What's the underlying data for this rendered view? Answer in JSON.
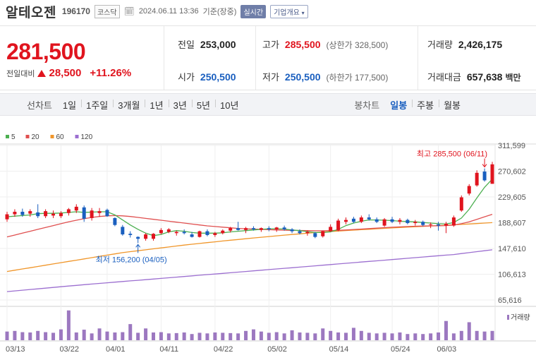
{
  "header": {
    "name": "알테오젠",
    "code": "196170",
    "market_badge": "코스닥",
    "datetime": "2024.06.11 13:36",
    "basis": "기준(장중)",
    "live_label": "실시간",
    "corp_label": "기업개요"
  },
  "quote": {
    "price": "281,500",
    "change_label": "전일대비",
    "change_amount": "28,500",
    "change_pct": "+11.26%",
    "prev_label": "전일",
    "prev_value": "253,000",
    "high_label": "고가",
    "high_value": "285,500",
    "upper_limit_text": "(상한가 328,500)",
    "volume_label": "거래량",
    "volume_value": "2,426,175",
    "open_label": "시가",
    "open_value": "250,500",
    "low_label": "저가",
    "low_value": "250,500",
    "lower_limit_text": "(하한가 177,500)",
    "amount_label": "거래대금",
    "amount_value": "657,638",
    "amount_unit": "백만"
  },
  "periods": {
    "line_label": "선차트",
    "line_items": [
      "1일",
      "1주일",
      "3개월",
      "1년",
      "3년",
      "5년",
      "10년"
    ],
    "candle_label": "봉차트",
    "candle_items": [
      "일봉",
      "주봉",
      "월봉"
    ],
    "candle_selected": 0
  },
  "colors": {
    "up": "#e0141e",
    "down": "#1a5fbf",
    "ma5": "#4caf50",
    "ma20": "#e05050",
    "ma60": "#f0962a",
    "ma120": "#9c6fd0",
    "volume": "#9c78c0"
  },
  "chart_data": {
    "type": "candlestick",
    "legend": [
      {
        "name": "5",
        "color": "#4caf50"
      },
      {
        "name": "20",
        "color": "#e05050"
      },
      {
        "name": "60",
        "color": "#f0962a"
      },
      {
        "name": "120",
        "color": "#9c6fd0"
      }
    ],
    "y_ticks": [
      "311,599",
      "270,602",
      "229,605",
      "188,607",
      "147,610",
      "106,613",
      "65,616"
    ],
    "y_tick_values": [
      311599,
      270602,
      229605,
      188607,
      147610,
      106613,
      65616
    ],
    "ylim": [
      65616,
      311599
    ],
    "x_tick_labels": [
      "03/13",
      "03/22",
      "04/01",
      "04/11",
      "04/22",
      "05/02",
      "05/14",
      "05/24",
      "06/03"
    ],
    "x_tick_index": [
      0,
      7,
      13,
      20,
      27,
      34,
      42,
      50,
      56
    ],
    "high_annotation": "최고 285,500 (06/11)",
    "low_annotation": "최저 156,200 (04/05)",
    "high_index": 62,
    "low_index": 17,
    "volume_label": "거래량",
    "candles": [
      {
        "o": 194000,
        "h": 206000,
        "l": 190000,
        "c": 202000
      },
      {
        "o": 202000,
        "h": 210000,
        "l": 198000,
        "c": 206000
      },
      {
        "o": 206000,
        "h": 211000,
        "l": 198000,
        "c": 201000
      },
      {
        "o": 203000,
        "h": 210000,
        "l": 198000,
        "c": 207000
      },
      {
        "o": 205000,
        "h": 218000,
        "l": 196000,
        "c": 199000
      },
      {
        "o": 199000,
        "h": 210000,
        "l": 196000,
        "c": 207000
      },
      {
        "o": 200000,
        "h": 208000,
        "l": 196000,
        "c": 203000
      },
      {
        "o": 199000,
        "h": 207000,
        "l": 196000,
        "c": 204000
      },
      {
        "o": 204000,
        "h": 212000,
        "l": 200000,
        "c": 210000
      },
      {
        "o": 208000,
        "h": 218000,
        "l": 204000,
        "c": 214000
      },
      {
        "o": 213000,
        "h": 216000,
        "l": 190000,
        "c": 195000
      },
      {
        "o": 196000,
        "h": 212000,
        "l": 192000,
        "c": 208000
      },
      {
        "o": 204000,
        "h": 212000,
        "l": 198000,
        "c": 207000
      },
      {
        "o": 209000,
        "h": 211000,
        "l": 198000,
        "c": 199000
      },
      {
        "o": 196000,
        "h": 197000,
        "l": 183000,
        "c": 185000
      },
      {
        "o": 182000,
        "h": 185000,
        "l": 168000,
        "c": 170000
      },
      {
        "o": 171000,
        "h": 175000,
        "l": 165000,
        "c": 169000
      },
      {
        "o": 166000,
        "h": 167000,
        "l": 156200,
        "c": 163000
      },
      {
        "o": 163000,
        "h": 172000,
        "l": 160000,
        "c": 170000
      },
      {
        "o": 163000,
        "h": 172000,
        "l": 160000,
        "c": 171000
      },
      {
        "o": 172000,
        "h": 180000,
        "l": 170000,
        "c": 177000
      },
      {
        "o": 174000,
        "h": 180000,
        "l": 172000,
        "c": 178000
      },
      {
        "o": 172000,
        "h": 176000,
        "l": 168000,
        "c": 174000
      },
      {
        "o": 174000,
        "h": 178000,
        "l": 170000,
        "c": 172000
      },
      {
        "o": 170000,
        "h": 174000,
        "l": 165000,
        "c": 166000
      },
      {
        "o": 166000,
        "h": 176000,
        "l": 165000,
        "c": 175000
      },
      {
        "o": 175000,
        "h": 178000,
        "l": 167000,
        "c": 169000
      },
      {
        "o": 169000,
        "h": 174000,
        "l": 166000,
        "c": 172000
      },
      {
        "o": 172000,
        "h": 178000,
        "l": 170000,
        "c": 176000
      },
      {
        "o": 176000,
        "h": 182000,
        "l": 173000,
        "c": 180000
      },
      {
        "o": 180000,
        "h": 190000,
        "l": 176000,
        "c": 177000
      },
      {
        "o": 177000,
        "h": 182000,
        "l": 172000,
        "c": 180000
      },
      {
        "o": 180000,
        "h": 183000,
        "l": 176000,
        "c": 178000
      },
      {
        "o": 177000,
        "h": 181000,
        "l": 174000,
        "c": 180000
      },
      {
        "o": 180000,
        "h": 183000,
        "l": 175000,
        "c": 178000
      },
      {
        "o": 178000,
        "h": 182000,
        "l": 174000,
        "c": 181000
      },
      {
        "o": 181000,
        "h": 184000,
        "l": 176000,
        "c": 178000
      },
      {
        "o": 178000,
        "h": 180000,
        "l": 172000,
        "c": 175000
      },
      {
        "o": 175000,
        "h": 178000,
        "l": 170000,
        "c": 172000
      },
      {
        "o": 172000,
        "h": 176000,
        "l": 168000,
        "c": 174000
      },
      {
        "o": 172000,
        "h": 174000,
        "l": 164000,
        "c": 166000
      },
      {
        "o": 167000,
        "h": 176000,
        "l": 165000,
        "c": 175000
      },
      {
        "o": 175000,
        "h": 186000,
        "l": 174000,
        "c": 182000
      },
      {
        "o": 177000,
        "h": 195000,
        "l": 175000,
        "c": 192000
      },
      {
        "o": 190000,
        "h": 197000,
        "l": 186000,
        "c": 193000
      },
      {
        "o": 195000,
        "h": 198000,
        "l": 188000,
        "c": 190000
      },
      {
        "o": 190000,
        "h": 200000,
        "l": 188000,
        "c": 197000
      },
      {
        "o": 197000,
        "h": 202000,
        "l": 192000,
        "c": 194000
      },
      {
        "o": 194000,
        "h": 197000,
        "l": 188000,
        "c": 190000
      },
      {
        "o": 184000,
        "h": 196000,
        "l": 182000,
        "c": 194000
      },
      {
        "o": 194000,
        "h": 198000,
        "l": 188000,
        "c": 190000
      },
      {
        "o": 190000,
        "h": 196000,
        "l": 186000,
        "c": 193000
      },
      {
        "o": 193000,
        "h": 195000,
        "l": 186000,
        "c": 188000
      },
      {
        "o": 188000,
        "h": 193000,
        "l": 184000,
        "c": 190000
      },
      {
        "o": 190000,
        "h": 192000,
        "l": 183000,
        "c": 185000
      },
      {
        "o": 185000,
        "h": 189000,
        "l": 180000,
        "c": 186000
      },
      {
        "o": 186000,
        "h": 190000,
        "l": 176000,
        "c": 184000
      },
      {
        "o": 184000,
        "h": 190000,
        "l": 172000,
        "c": 187000
      },
      {
        "o": 184000,
        "h": 200000,
        "l": 182000,
        "c": 197000
      },
      {
        "o": 208000,
        "h": 232000,
        "l": 206000,
        "c": 229000
      },
      {
        "o": 235000,
        "h": 250000,
        "l": 232000,
        "c": 247000
      },
      {
        "o": 248000,
        "h": 272000,
        "l": 246000,
        "c": 268000
      },
      {
        "o": 270000,
        "h": 275000,
        "l": 254000,
        "c": 256000
      },
      {
        "o": 250500,
        "h": 285500,
        "l": 250500,
        "c": 281500
      }
    ],
    "ma5": [
      198000,
      199000,
      200000,
      201000,
      203000,
      203500,
      203500,
      204000,
      205000,
      206000,
      205000,
      205500,
      206000,
      206000,
      201000,
      193000,
      185000,
      178000,
      172000,
      168000,
      170000,
      174000,
      176000,
      175000,
      173000,
      172000,
      172000,
      172000,
      172500,
      174000,
      175000,
      176000,
      177000,
      178000,
      179000,
      179000,
      178500,
      177000,
      176000,
      174500,
      173000,
      173000,
      174000,
      178000,
      184000,
      188000,
      191000,
      193000,
      193000,
      192500,
      192000,
      191000,
      190500,
      190000,
      189000,
      188000,
      187000,
      186500,
      189000,
      196000,
      210000,
      228000,
      245000,
      258000
    ],
    "ma20": [
      166000,
      169000,
      172000,
      175000,
      178000,
      181000,
      184000,
      187000,
      190000,
      192500,
      195000,
      197000,
      198500,
      199500,
      200000,
      199500,
      198500,
      197000,
      195500,
      194000,
      192500,
      191000,
      189500,
      188000,
      186500,
      185000,
      183500,
      182500,
      181500,
      180500,
      179500,
      179000,
      178500,
      178000,
      177500,
      177000,
      176700,
      176400,
      176200,
      176000,
      175800,
      175800,
      176000,
      176500,
      177000,
      177800,
      178500,
      179300,
      180000,
      180700,
      181400,
      182000,
      182500,
      183000,
      183300,
      183600,
      183800,
      184000,
      185000,
      187000,
      190000,
      194000,
      198000,
      202000
    ],
    "ma60": [
      111000,
      113000,
      115000,
      117000,
      119000,
      121000,
      123000,
      125000,
      127000,
      129000,
      131000,
      133000,
      135000,
      137000,
      139000,
      141000,
      142500,
      144000,
      145500,
      147000,
      148500,
      150000,
      151500,
      153000,
      154300,
      155600,
      156900,
      158200,
      159500,
      160700,
      161900,
      163100,
      164300,
      165500,
      166600,
      167700,
      168800,
      169900,
      170900,
      171900,
      172900,
      173800,
      174600,
      175400,
      176100,
      176800,
      177500,
      178200,
      178900,
      179600,
      180300,
      181000,
      181600,
      182200,
      182800,
      183400,
      184000,
      184600,
      185200,
      185900,
      186600,
      187300,
      188000,
      188700
    ],
    "ma120": [
      79000,
      80100,
      81200,
      82300,
      83400,
      84500,
      85600,
      86700,
      87800,
      88900,
      90000,
      91000,
      92000,
      93000,
      94000,
      95000,
      96000,
      97000,
      98000,
      99000,
      100000,
      101000,
      102000,
      103000,
      104000,
      105000,
      106000,
      107000,
      108000,
      109000,
      110000,
      111000,
      112000,
      113000,
      114000,
      115000,
      116000,
      117000,
      118000,
      119000,
      120000,
      121000,
      122000,
      123000,
      124000,
      125000,
      126000,
      127000,
      128000,
      129000,
      130000,
      131000,
      132000,
      133000,
      134000,
      135000,
      136000,
      137000,
      138000,
      139500,
      141000,
      142500,
      144000,
      145500
    ],
    "volume": [
      0.28,
      0.3,
      0.26,
      0.25,
      0.3,
      0.26,
      0.24,
      0.35,
      0.96,
      0.25,
      0.34,
      0.22,
      0.38,
      0.28,
      0.25,
      0.26,
      0.52,
      0.24,
      0.38,
      0.25,
      0.26,
      0.22,
      0.23,
      0.25,
      0.2,
      0.24,
      0.22,
      0.25,
      0.24,
      0.23,
      0.22,
      0.3,
      0.35,
      0.28,
      0.24,
      0.26,
      0.22,
      0.32,
      0.25,
      0.24,
      0.22,
      0.38,
      0.3,
      0.25,
      0.24,
      0.4,
      0.3,
      0.24,
      0.22,
      0.24,
      0.22,
      0.25,
      0.2,
      0.22,
      0.2,
      0.22,
      0.25,
      0.62,
      0.22,
      0.3,
      0.58,
      0.3,
      0.28,
      0.3
    ]
  }
}
